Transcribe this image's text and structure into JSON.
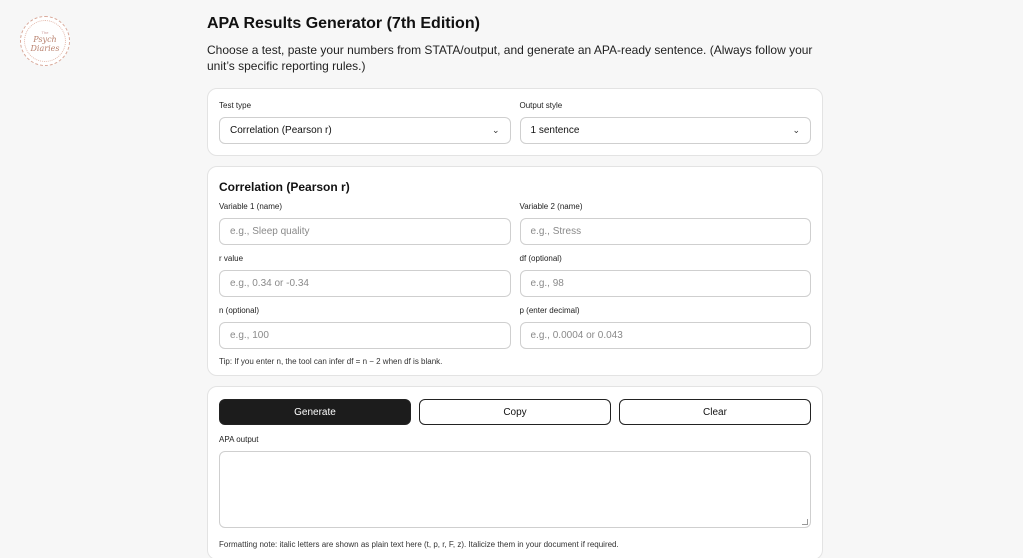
{
  "logo": {
    "top": "The",
    "line1": "Psych",
    "line2": "Diaries"
  },
  "header": {
    "title": "APA Results Generator (7th Edition)",
    "subtitle": "Choose a test, paste your numbers from STATA/output, and generate an APA-ready sentence. (Always follow your unit’s specific reporting rules.)"
  },
  "settings": {
    "test_type_label": "Test type",
    "test_type_value": "Correlation (Pearson r)",
    "output_style_label": "Output style",
    "output_style_value": "1 sentence"
  },
  "form": {
    "heading": "Correlation (Pearson r)",
    "var1_label": "Variable 1 (name)",
    "var1_placeholder": "e.g., Sleep quality",
    "var2_label": "Variable 2 (name)",
    "var2_placeholder": "e.g., Stress",
    "r_label": "r value",
    "r_placeholder": "e.g., 0.34 or -0.34",
    "df_label": "df (optional)",
    "df_placeholder": "e.g., 98",
    "n_label": "n (optional)",
    "n_placeholder": "e.g., 100",
    "p_label": "p (enter decimal)",
    "p_placeholder": "e.g., 0.0004 or 0.043",
    "tip": "Tip: If you enter n, the tool can infer df = n − 2 when df is blank."
  },
  "actions": {
    "generate_label": "Generate",
    "copy_label": "Copy",
    "clear_label": "Clear",
    "output_label": "APA output",
    "output_value": "",
    "note": "Formatting note: italic letters are shown as plain text here (t, p, r, F, z). Italicize them in your document if required."
  },
  "icons": {
    "chevron": "chevron-down-icon"
  }
}
